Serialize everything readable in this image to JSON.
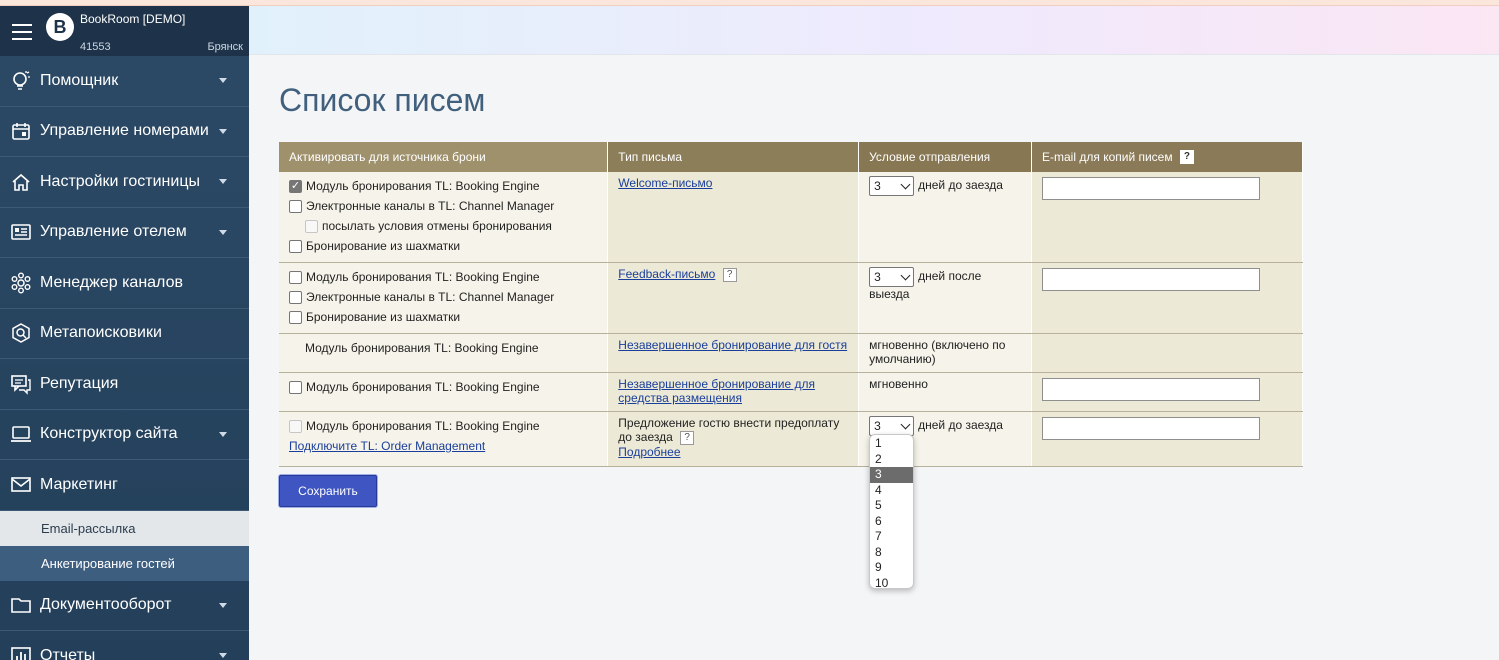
{
  "app": {
    "brand": "BookRoom [DEMO]",
    "logo_letter": "B",
    "hotel_id": "41553",
    "city": "Брянск"
  },
  "sidebar": {
    "items": [
      {
        "label": "Помощник",
        "icon": "lightbulb-icon"
      },
      {
        "label": "Управление номерами",
        "icon": "calendar-icon"
      },
      {
        "label": "Настройки гостиницы",
        "icon": "home-icon"
      },
      {
        "label": "Управление отелем",
        "icon": "dashboard-icon"
      },
      {
        "label": "Менеджер каналов",
        "icon": "hexagon-network-icon"
      },
      {
        "label": "Метапоисковики",
        "icon": "search-icon"
      },
      {
        "label": "Репутация",
        "icon": "chat-icon"
      },
      {
        "label": "Конструктор сайта",
        "icon": "laptop-icon"
      },
      {
        "label": "Маркетинг",
        "icon": "mail-icon"
      },
      {
        "label": "Документооборот",
        "icon": "folder-icon"
      },
      {
        "label": "Отчеты",
        "icon": "bar-chart-icon"
      }
    ],
    "sub_items": [
      {
        "label": "Email-рассылка"
      },
      {
        "label": "Анкетирование гостей"
      }
    ]
  },
  "main": {
    "title": "Список писем",
    "table": {
      "headers": [
        "Активировать для источника брони",
        "Тип письма",
        "Условие отправления",
        "E-mail для копий писем"
      ],
      "help_mark": "?",
      "rows": [
        {
          "sources": [
            {
              "label": "Модуль бронирования TL: Booking Engine",
              "checked": true
            },
            {
              "label": "Электронные каналы в TL: Channel Manager",
              "checked": false
            },
            {
              "label": "посылать условия отмены бронирования",
              "checked": false,
              "disabled": true
            },
            {
              "label": "Бронирование из шахматки",
              "checked": false
            }
          ],
          "type_link": "Welcome-письмо",
          "days": "3",
          "condition": "дней  до заезда"
        },
        {
          "sources": [
            {
              "label": "Модуль бронирования TL: Booking Engine",
              "checked": false
            },
            {
              "label": "Электронные каналы в TL: Channel Manager",
              "checked": false
            },
            {
              "label": "Бронирование из шахматки",
              "checked": false
            }
          ],
          "type_link": "Feedback-письмо",
          "days": "3",
          "condition": "дней после выезда"
        },
        {
          "source_text": "Модуль бронирования TL: Booking Engine",
          "type_link": "Незавершенное бронирование для гостя",
          "condition": "мгновенно (включено по умолчанию)"
        },
        {
          "sources": [
            {
              "label": "Модуль бронирования TL: Booking Engine",
              "checked": false
            }
          ],
          "type_link": "Незавершенное бронирование для средства размещения",
          "condition": "мгновенно"
        },
        {
          "sources": [
            {
              "label": "Модуль бронирования TL: Booking Engine",
              "checked": false,
              "disabled": true
            }
          ],
          "connect_link": "Подключите TL: Order Management",
          "type_text": "Предложение гостю внести предоплату до заезда",
          "more_link": "Подробнее",
          "days": "3",
          "condition": "дней  до заезда"
        }
      ]
    },
    "save_label": "Сохранить",
    "dropdown": {
      "options": [
        "1",
        "2",
        "3",
        "4",
        "5",
        "6",
        "7",
        "8",
        "9",
        "10"
      ],
      "selected": "3"
    }
  }
}
